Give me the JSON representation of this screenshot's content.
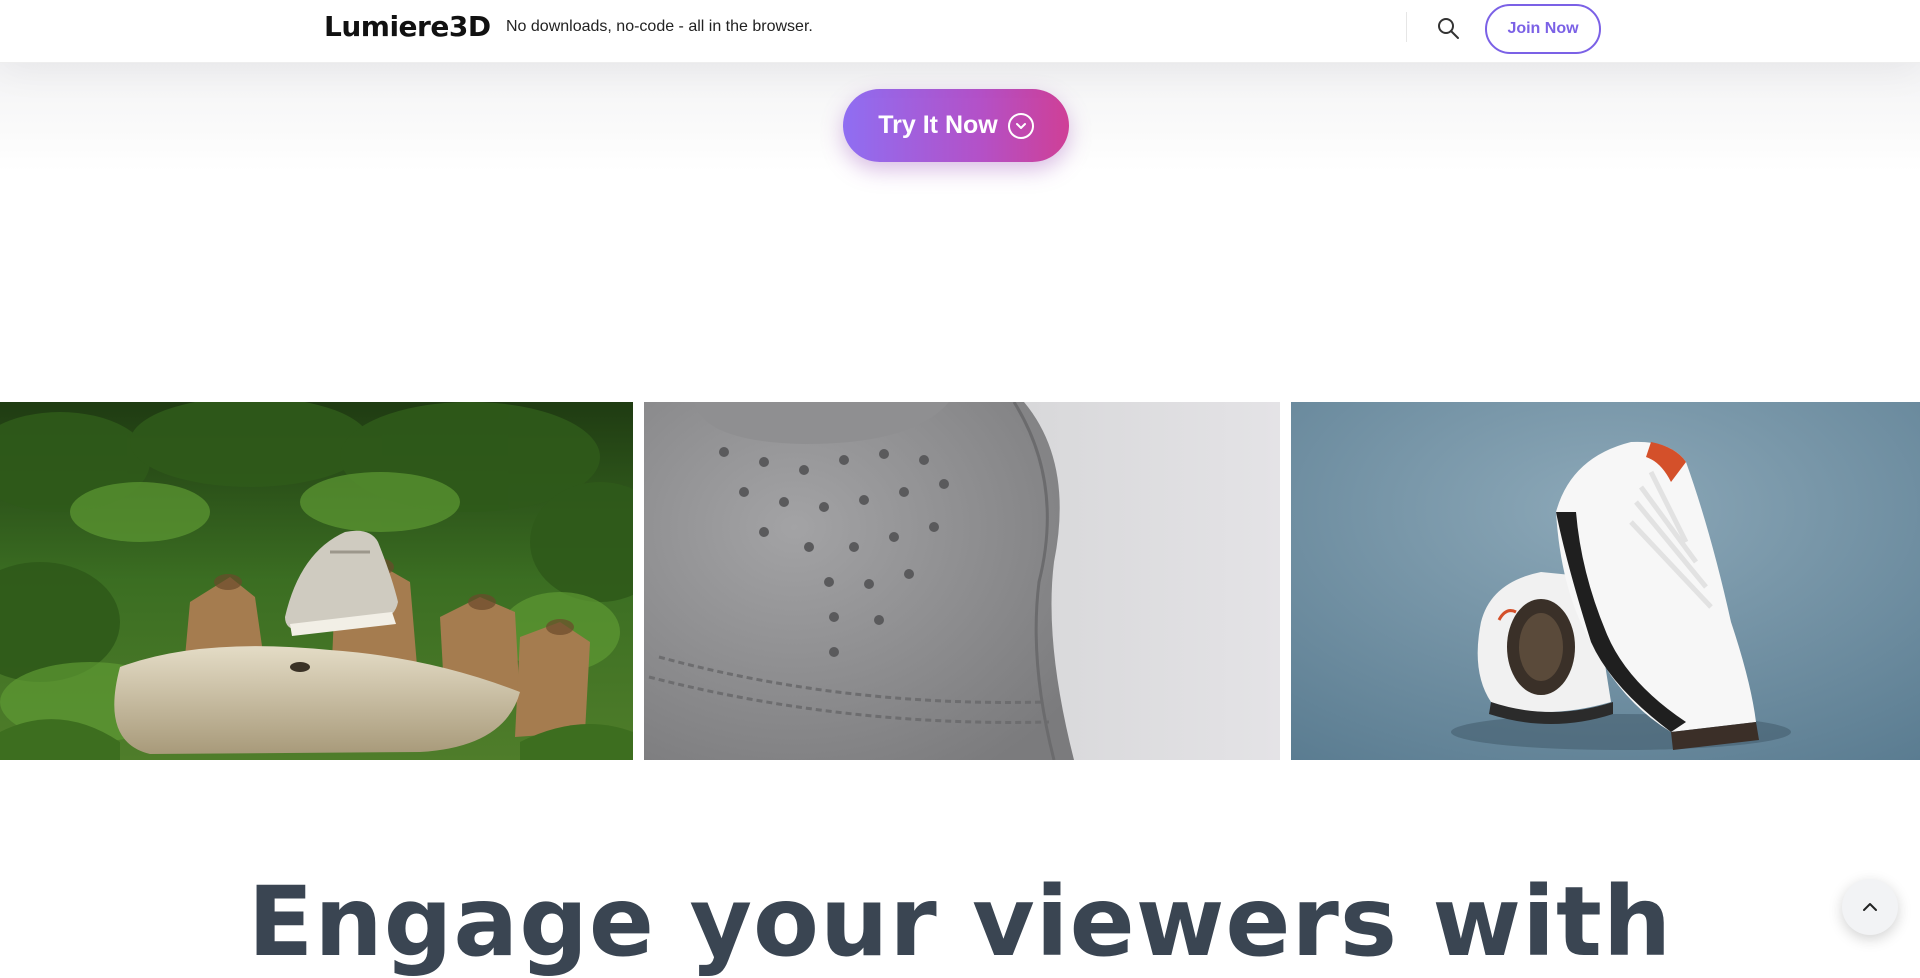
{
  "header": {
    "logo": "Lumiere3D",
    "tagline": "No downloads, no-code - all in the browser.",
    "search_icon": "search-icon",
    "join_label": "Join Now"
  },
  "hero": {
    "cta_label": "Try It Now",
    "cta_icon": "chevron-down-circle-icon"
  },
  "gallery": {
    "images": [
      {
        "subject": "sneaker on wooden stumps in grass",
        "accent": "#3f7a2a"
      },
      {
        "subject": "close-up of grey sneaker toe box",
        "accent": "#8a8a8c"
      },
      {
        "subject": "pair of white, black and red basketball sneakers",
        "accent": "#6f8fa3"
      }
    ]
  },
  "main": {
    "headline": "Engage your viewers with"
  },
  "scroll_top_icon": "chevron-up-icon",
  "colors": {
    "accent": "#7b61e6",
    "cta_gradient_start": "#8f6ef2",
    "cta_gradient_end": "#cf3f96",
    "headline": "#3a4552"
  }
}
